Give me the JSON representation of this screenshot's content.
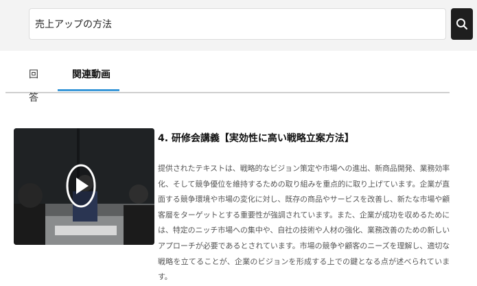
{
  "search": {
    "value": "売上アップの方法",
    "button_icon": "search-icon"
  },
  "tabs": [
    {
      "label": "回答",
      "active": false
    },
    {
      "label": "関連動画",
      "active": true
    }
  ],
  "accent_color": "#3a98d9",
  "video": {
    "title": "4. 研修会講義【実効性に高い戦略立案方法】",
    "description": "提供されたテキストは、戦略的なビジョン策定や市場への進出、新商品開発、業務効率化、そして競争優位を維持するための取り組みを重点的に取り上げています。企業が直面する競争環境や市場の変化に対し、既存の商品やサービスを改善し、新たな市場や顧客層をターゲットとする重要性が強調されています。また、企業が成功を収めるためには、特定のニッチ市場への集中や、自社の技術や人材の強化、業務改善のための新しいアプローチが必要であるとされています。市場の競争や顧客のニーズを理解し、適切な戦略を立てることが、企業のビジョンを形成する上での鍵となる点が述べられています。",
    "thumbnail_icon": "play-icon"
  }
}
